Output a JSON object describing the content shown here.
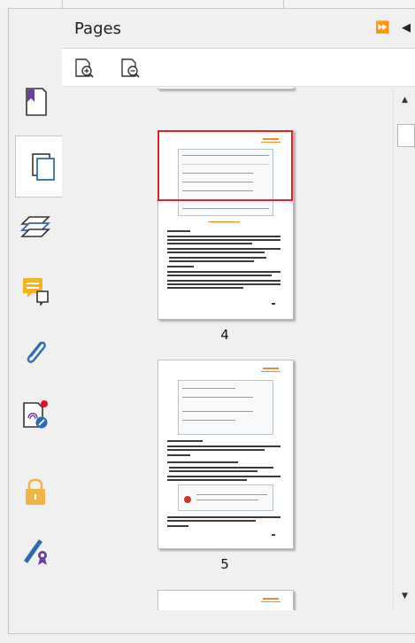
{
  "panel": {
    "title": "Pages",
    "header_controls": {
      "expand": "⏩",
      "collapse": "◀"
    }
  },
  "toolbar": {
    "buttons": [
      {
        "name": "zoom-in-page-icon"
      },
      {
        "name": "zoom-out-page-icon"
      }
    ]
  },
  "rail": {
    "items": [
      {
        "name": "bookmark-icon",
        "active": false
      },
      {
        "name": "pages-icon",
        "active": true
      },
      {
        "name": "layers-icon",
        "active": false
      },
      {
        "name": "comments-icon",
        "active": false
      },
      {
        "name": "attachments-icon",
        "active": false
      },
      {
        "name": "signature-icon",
        "active": false
      },
      {
        "name": "security-lock-icon",
        "active": false
      },
      {
        "name": "certificate-pen-icon",
        "active": false
      }
    ]
  },
  "pages": {
    "labels": [
      "4",
      "5"
    ]
  },
  "colors": {
    "selection": "#e8202a",
    "accent_orange": "#f08a2c",
    "bookmark_purple": "#6a3ea1",
    "blue": "#2b6cb0",
    "comment_yellow": "#f5b324",
    "lock_gold": "#f0b445",
    "signature_red": "#e0102a"
  }
}
